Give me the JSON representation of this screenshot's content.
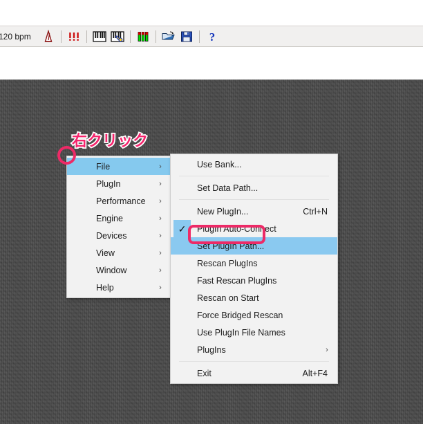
{
  "toolbar": {
    "tempo_label": "120 bpm",
    "buttons": [
      {
        "name": "metronome-icon",
        "title": "Metronome"
      },
      {
        "name": "exclamation-icon",
        "title": "Panic"
      },
      {
        "name": "keyboard-icon",
        "title": "Keyboard"
      },
      {
        "name": "keyboard-settings-icon",
        "title": "Keyboard Settings"
      },
      {
        "name": "level-meter-icon",
        "title": "Level Meters"
      },
      {
        "name": "open-folder-icon",
        "title": "Open"
      },
      {
        "name": "save-disk-icon",
        "title": "Save"
      },
      {
        "name": "help-icon",
        "title": "Help"
      }
    ]
  },
  "main_menu": {
    "items": [
      {
        "label": "File",
        "submenu": true,
        "selected": true
      },
      {
        "label": "PlugIn",
        "submenu": true,
        "selected": false
      },
      {
        "label": "Performance",
        "submenu": true,
        "selected": false
      },
      {
        "label": "Engine",
        "submenu": true,
        "selected": false
      },
      {
        "label": "Devices",
        "submenu": true,
        "selected": false
      },
      {
        "label": "View",
        "submenu": true,
        "selected": false
      },
      {
        "label": "Window",
        "submenu": true,
        "selected": false
      },
      {
        "label": "Help",
        "submenu": true,
        "selected": false
      }
    ]
  },
  "sub_menu": {
    "items": [
      {
        "label": "Use Bank...",
        "accel": "",
        "submenu": false,
        "checked": false,
        "selected": false
      },
      {
        "type": "separator"
      },
      {
        "label": "Set Data Path...",
        "accel": "",
        "submenu": false,
        "checked": false,
        "selected": false
      },
      {
        "type": "separator"
      },
      {
        "label": "New PlugIn...",
        "accel": "Ctrl+N",
        "submenu": false,
        "checked": false,
        "selected": false
      },
      {
        "label": "PlugIn Auto-Connect",
        "accel": "",
        "submenu": false,
        "checked": true,
        "selected": false
      },
      {
        "label": "Set PlugIn Path...",
        "accel": "",
        "submenu": false,
        "checked": false,
        "selected": true
      },
      {
        "label": "Rescan PlugIns",
        "accel": "",
        "submenu": false,
        "checked": false,
        "selected": false
      },
      {
        "label": "Fast Rescan PlugIns",
        "accel": "",
        "submenu": false,
        "checked": false,
        "selected": false
      },
      {
        "label": "Rescan on Start",
        "accel": "",
        "submenu": false,
        "checked": false,
        "selected": false
      },
      {
        "label": "Force Bridged Rescan",
        "accel": "",
        "submenu": false,
        "checked": false,
        "selected": false
      },
      {
        "label": "Use PlugIn File Names",
        "accel": "",
        "submenu": false,
        "checked": false,
        "selected": false
      },
      {
        "label": "PlugIns",
        "accel": "",
        "submenu": true,
        "checked": false,
        "selected": false
      },
      {
        "type": "separator"
      },
      {
        "label": "Exit",
        "accel": "Alt+F4",
        "submenu": false,
        "checked": false,
        "selected": false
      }
    ],
    "arrow_glyph": "›",
    "check_glyph": "✓"
  },
  "annotations": {
    "right_click_text": "右クリック",
    "circle_color": "#ed2a67",
    "box_color": "#ed2a67",
    "text_color": "#f5256d"
  },
  "colors": {
    "menu_bg": "#f2f2f2",
    "menu_highlight": "#8ac9f0",
    "desktop_bg": "#4b4b4b",
    "toolbar_bg": "#f1f0ef"
  }
}
